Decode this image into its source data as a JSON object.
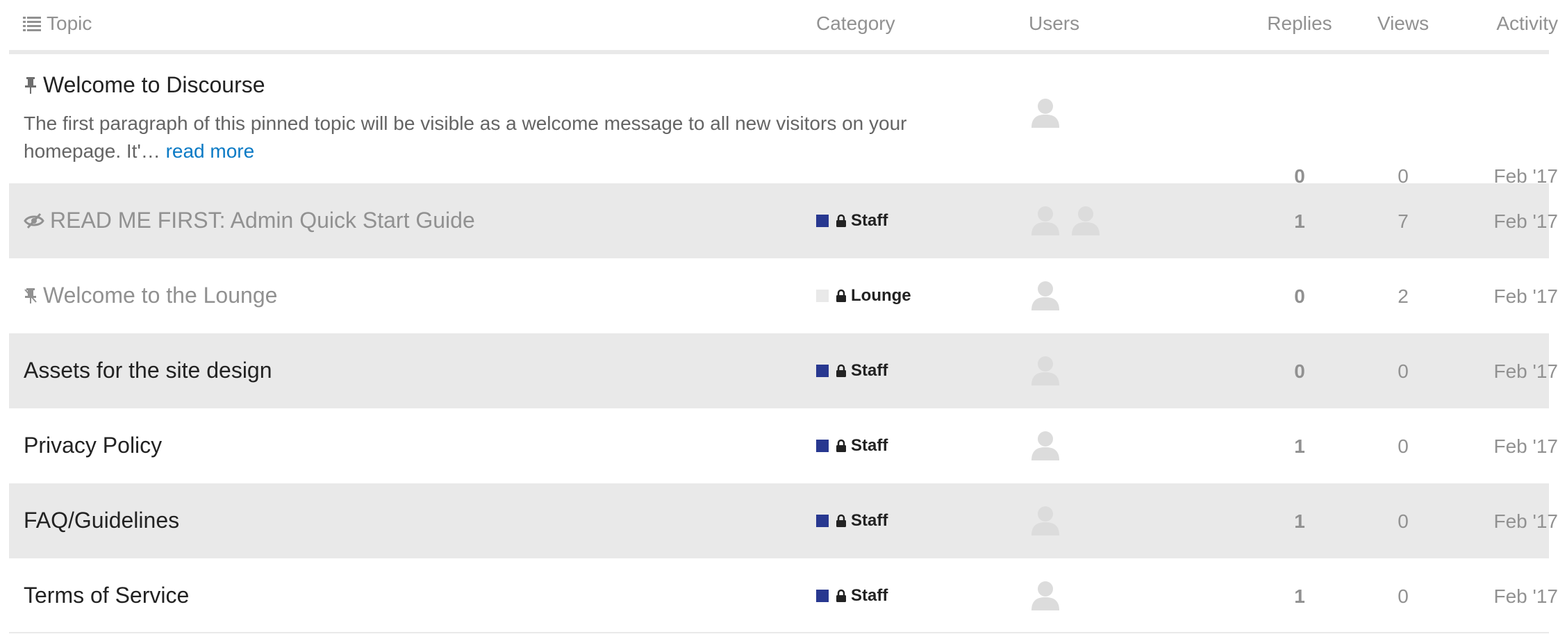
{
  "header": {
    "topic": "Topic",
    "category": "Category",
    "users": "Users",
    "replies": "Replies",
    "views": "Views",
    "activity": "Activity"
  },
  "colors": {
    "staff": "#283890",
    "lounge": "#e9e9e9",
    "link": "#0a7ac5",
    "muted": "#919191",
    "row_shade": "#e9e9e9"
  },
  "rows": [
    {
      "title": "Welcome to Discourse",
      "icon": "pin-icon",
      "excerpt": "The first paragraph of this pinned topic will be visible as a welcome message to all new visitors on your homepage. It'…",
      "read_more": "read more",
      "category": "",
      "users": 1,
      "replies": "0",
      "views": "0",
      "activity": "Feb '17"
    },
    {
      "title": "READ ME FIRST: Admin Quick Start Guide",
      "icon": "eye-slash-icon",
      "category": "Staff",
      "users": 2,
      "replies": "1",
      "views": "7",
      "activity": "Feb '17"
    },
    {
      "title": "Welcome to the Lounge",
      "icon": "pin-icon",
      "category": "Lounge",
      "users": 1,
      "replies": "0",
      "views": "2",
      "activity": "Feb '17"
    },
    {
      "title": "Assets for the site design",
      "category": "Staff",
      "users": 1,
      "replies": "0",
      "views": "0",
      "activity": "Feb '17"
    },
    {
      "title": "Privacy Policy",
      "category": "Staff",
      "users": 1,
      "replies": "1",
      "views": "0",
      "activity": "Feb '17"
    },
    {
      "title": "FAQ/Guidelines",
      "category": "Staff",
      "users": 1,
      "replies": "1",
      "views": "0",
      "activity": "Feb '17"
    },
    {
      "title": "Terms of Service",
      "category": "Staff",
      "users": 1,
      "replies": "1",
      "views": "0",
      "activity": "Feb '17"
    }
  ]
}
